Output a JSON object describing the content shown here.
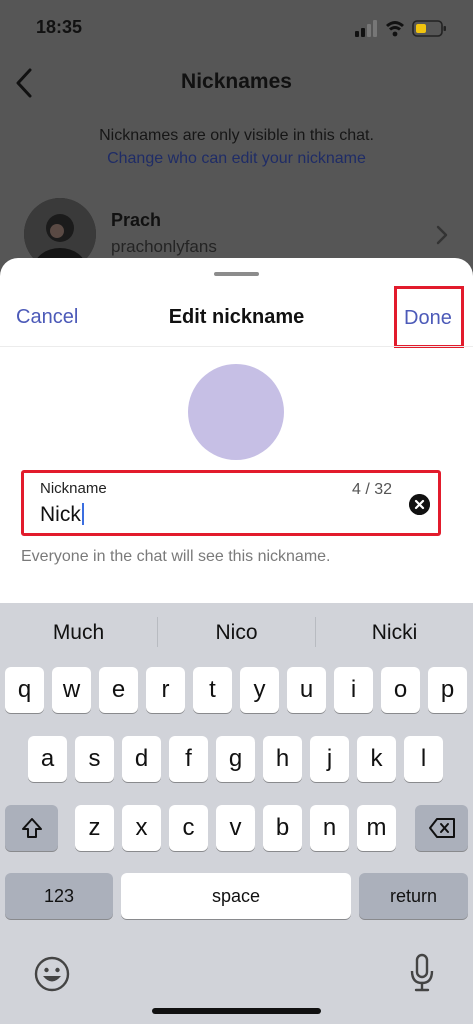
{
  "status_bar": {
    "time": "18:35"
  },
  "header": {
    "title": "Nicknames"
  },
  "info": {
    "text": "Nicknames are only visible in this chat.",
    "link": "Change who can edit your nickname"
  },
  "member": {
    "name": "Prach",
    "handle": "prachonlyfans"
  },
  "sheet": {
    "cancel_label": "Cancel",
    "title": "Edit nickname",
    "done_label": "Done",
    "field": {
      "label": "Nickname",
      "value": "Nick",
      "counter": "4 / 32"
    },
    "help_text": "Everyone in the chat will see this nickname."
  },
  "keyboard": {
    "suggestions": [
      "Much",
      "Nico",
      "Nicki"
    ],
    "row1": [
      "q",
      "w",
      "e",
      "r",
      "t",
      "y",
      "u",
      "i",
      "o",
      "p"
    ],
    "row2": [
      "a",
      "s",
      "d",
      "f",
      "g",
      "h",
      "j",
      "k",
      "l"
    ],
    "row3": [
      "z",
      "x",
      "c",
      "v",
      "b",
      "n",
      "m"
    ],
    "numbers_label": "123",
    "space_label": "space",
    "return_label": "return",
    "icons": [
      "shift-icon",
      "backspace-icon",
      "emoji-icon",
      "microphone-icon"
    ]
  },
  "colors": {
    "accent": "#4c5ab8",
    "highlight_box": "#e21b2c",
    "avatar_placeholder": "#c6bfe5"
  }
}
